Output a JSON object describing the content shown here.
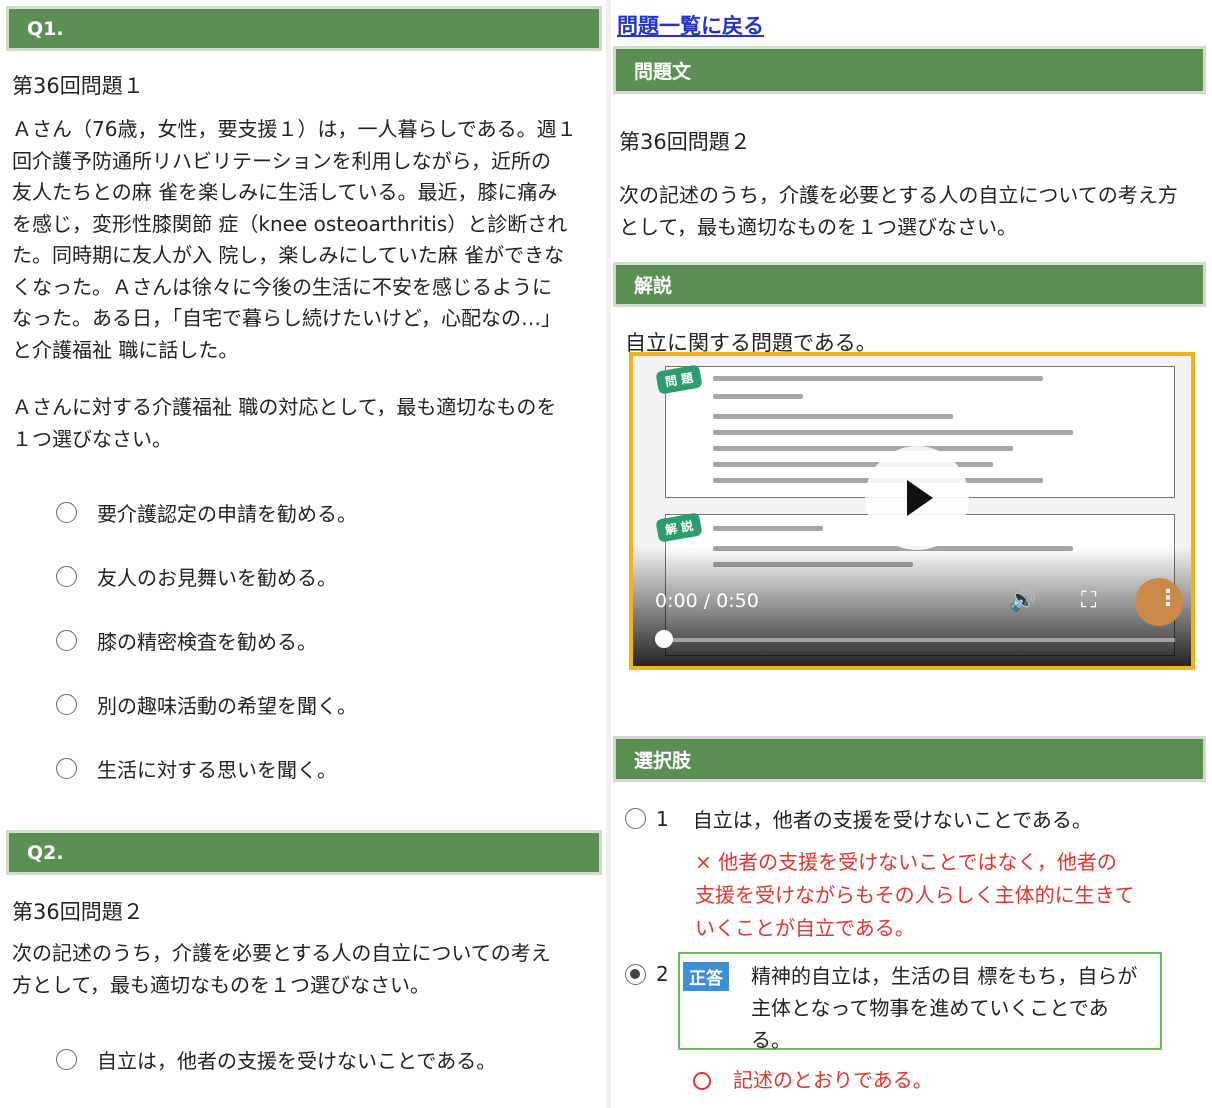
{
  "left": {
    "q1": {
      "header": "Q1.",
      "subtitle": "第36回問題１",
      "body": [
        "Ａさん（76歳，女性，要支援１）は，一人暮らしである。週１",
        "回介護予防通所リハビリテーションを利用しながら，近所の",
        "友人たちとの麻 雀を楽しみに生活している。最近，膝に痛み",
        "を感じ，変形性膝関節 症（knee osteoarthritis）と診断され",
        "た。同時期に友人が入 院し，楽しみにしていた麻 雀ができな",
        "くなった。Ａさんは徐々に今後の生活に不安を感じるように",
        "なった。ある日，「自宅で暮らし続けたいけど，心配なの…」",
        "と介護福祉 職に話した。"
      ],
      "question": [
        "Ａさんに対する介護福祉 職の対応として，最も適切なものを",
        "１つ選びなさい。"
      ],
      "options": [
        "要介護認定の申請を勧める。",
        "友人のお見舞いを勧める。",
        "膝の精密検査を勧める。",
        "別の趣味活動の希望を聞く。",
        "生活に対する思いを聞く。"
      ]
    },
    "q2": {
      "header": "Q2.",
      "subtitle": "第36回問題２",
      "body": [
        "次の記述のうち，介護を必要とする人の自立についての考え",
        "方として，最も適切なものを１つ選びなさい。"
      ],
      "options": [
        "自立は，他者の支援を受けないことである。"
      ]
    }
  },
  "right": {
    "back_link": "問題一覧に戻る",
    "question_header": "問題文",
    "subtitle": "第36回問題２",
    "body": [
      "次の記述のうち，介護を必要とする人の自立についての考え方",
      "として，最も適切なものを１つ選びなさい。"
    ],
    "explanation_header": "解説",
    "explanation_text": "自立に関する問題である。",
    "video": {
      "time": "0:00 / 0:50",
      "tag_question": "問 題",
      "tag_explanation": "解 説"
    },
    "choices_header": "選択肢",
    "choices": [
      {
        "number": "1",
        "text": "自立は，他者の支援を受けないことである。",
        "feedback": [
          "× 他者の支援を受けないことではなく，他者の",
          "支援を受けながらもその人らしく主体的に生きて",
          "いくことが自立である。"
        ]
      },
      {
        "number": "2",
        "badge": "正答",
        "text": [
          "精神的自立は，生活の目 標をもち，自らが",
          "主体となって物事を進めていくことであ",
          "る。"
        ],
        "feedback": "記述のとおりである。"
      }
    ]
  },
  "colors": {
    "header_green": "#5b8f53",
    "link_blue": "#2233cc",
    "wrong_red": "#e0362c",
    "correct_green_border": "#6cbb5c",
    "badge_blue": "#3c8ed6",
    "video_border": "#f2b21b"
  }
}
